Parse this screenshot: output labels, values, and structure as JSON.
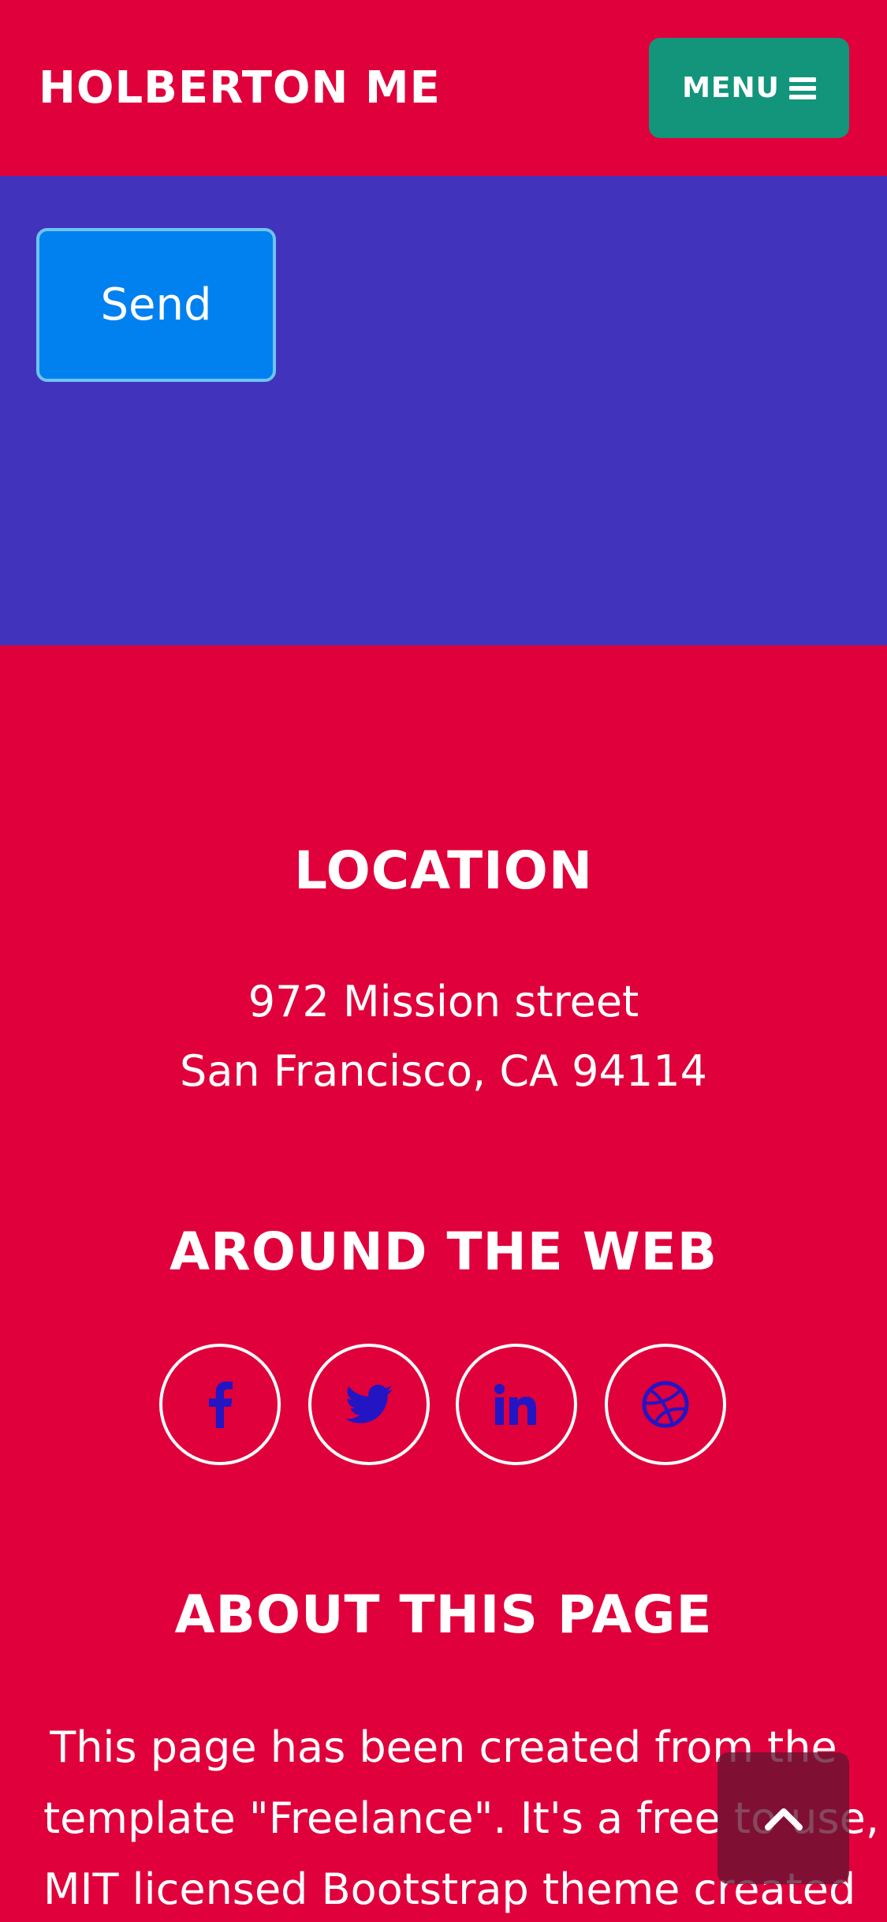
{
  "navbar": {
    "brand": "HOLBERTON ME",
    "menu_label": "MENU",
    "menu_icon": "bars-icon"
  },
  "contact": {
    "send_label": "Send"
  },
  "footer": {
    "location_heading": "LOCATION",
    "address_line1": "972 Mission street",
    "address_line2": "San Francisco, CA 94114",
    "web_heading": "AROUND THE WEB",
    "social": [
      {
        "icon": "facebook-icon"
      },
      {
        "icon": "twitter-icon"
      },
      {
        "icon": "linkedin-icon"
      },
      {
        "icon": "dribbble-icon"
      }
    ],
    "about_heading": "ABOUT THIS PAGE",
    "about_lines": [
      "This page has been created from the",
      "template \"Freelance\". It's a free to use,",
      "MIT licensed Bootstrap theme created"
    ]
  },
  "scroll_top": {
    "icon": "chevron-up-icon"
  },
  "colors": {
    "primary_red": "#e0003b",
    "menu_green": "#12957a",
    "contact_blue": "#4233bd",
    "send_blue": "#0181ef",
    "social_icon_blue": "#2415c4",
    "scroll_top_bg": "#6e1432"
  }
}
